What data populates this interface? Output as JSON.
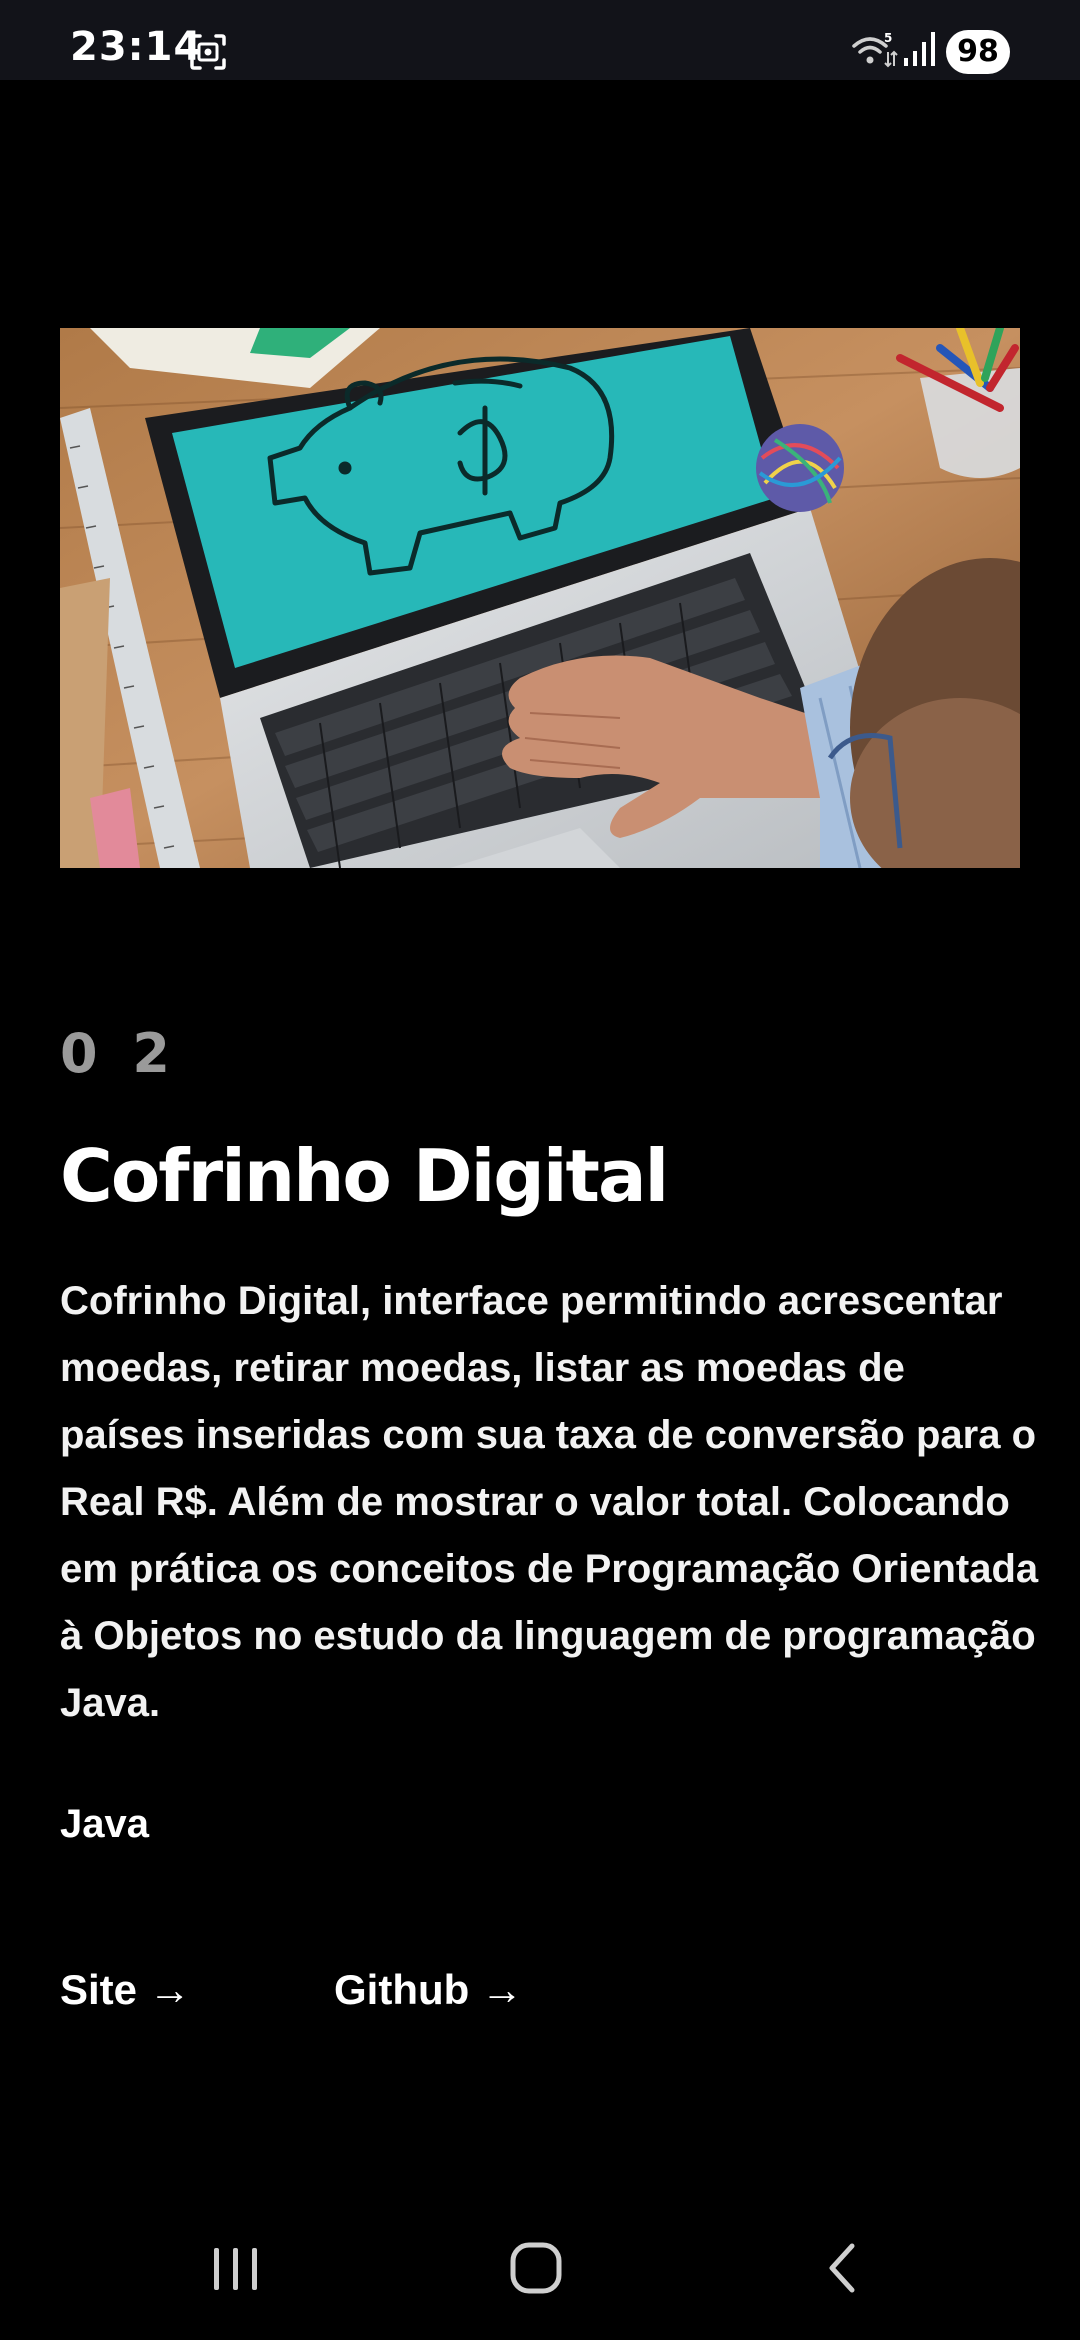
{
  "status_bar": {
    "time": "23:14",
    "battery": "98",
    "icons": [
      "screenshot-icon",
      "wifi-icon",
      "signal-icon"
    ]
  },
  "hero_image": {
    "subject": "laptop-piggy-bank-photo"
  },
  "project": {
    "number": "0 2",
    "title": "Cofrinho Digital",
    "description": "Cofrinho Digital, interface permitindo acrescentar moedas, retirar moedas, listar as moedas de países inseridas com sua taxa de conversão para o Real R$. Além de mostrar o valor total. Colocando em prática os conceitos de Programação Orientada à Objetos no estudo da linguagem de programação Java.",
    "tech": "Java"
  },
  "links": {
    "site": "Site →",
    "github": "Github →"
  },
  "nav_bar": {
    "icons": [
      "recents-icon",
      "home-icon",
      "back-icon"
    ]
  },
  "colors": {
    "background": "#000000",
    "status_bar": "#121319",
    "text": "#ffffff",
    "muted": "#9a9a9a",
    "screen_teal": "#27b8b8"
  }
}
